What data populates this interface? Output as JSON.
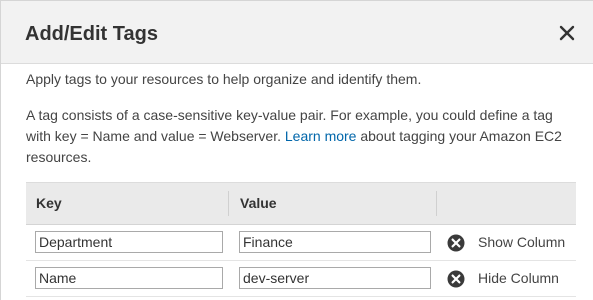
{
  "dialog": {
    "title": "Add/Edit Tags",
    "close_icon": "close-icon"
  },
  "intro_text": "Apply tags to your resources to help organize and identify them.",
  "description": {
    "before_link": "A tag consists of a case-sensitive key-value pair. For example, you could define a tag with key = Name and value = Webserver. ",
    "link_text": "Learn more",
    "after_link": " about tagging your Amazon EC2 resources."
  },
  "table": {
    "headers": {
      "key": "Key",
      "value": "Value"
    },
    "rows": [
      {
        "key": "Department",
        "value": "Finance",
        "remove_icon": "remove-circle-icon",
        "column_action": "Show Column"
      },
      {
        "key": "Name",
        "value": "dev-server",
        "remove_icon": "remove-circle-icon",
        "column_action": "Hide Column"
      }
    ]
  },
  "colors": {
    "link": "#0066aa",
    "header_bg": "#f2f2f2",
    "table_header_bg": "#eaeaea",
    "remove_icon": "#3a3a3a"
  }
}
